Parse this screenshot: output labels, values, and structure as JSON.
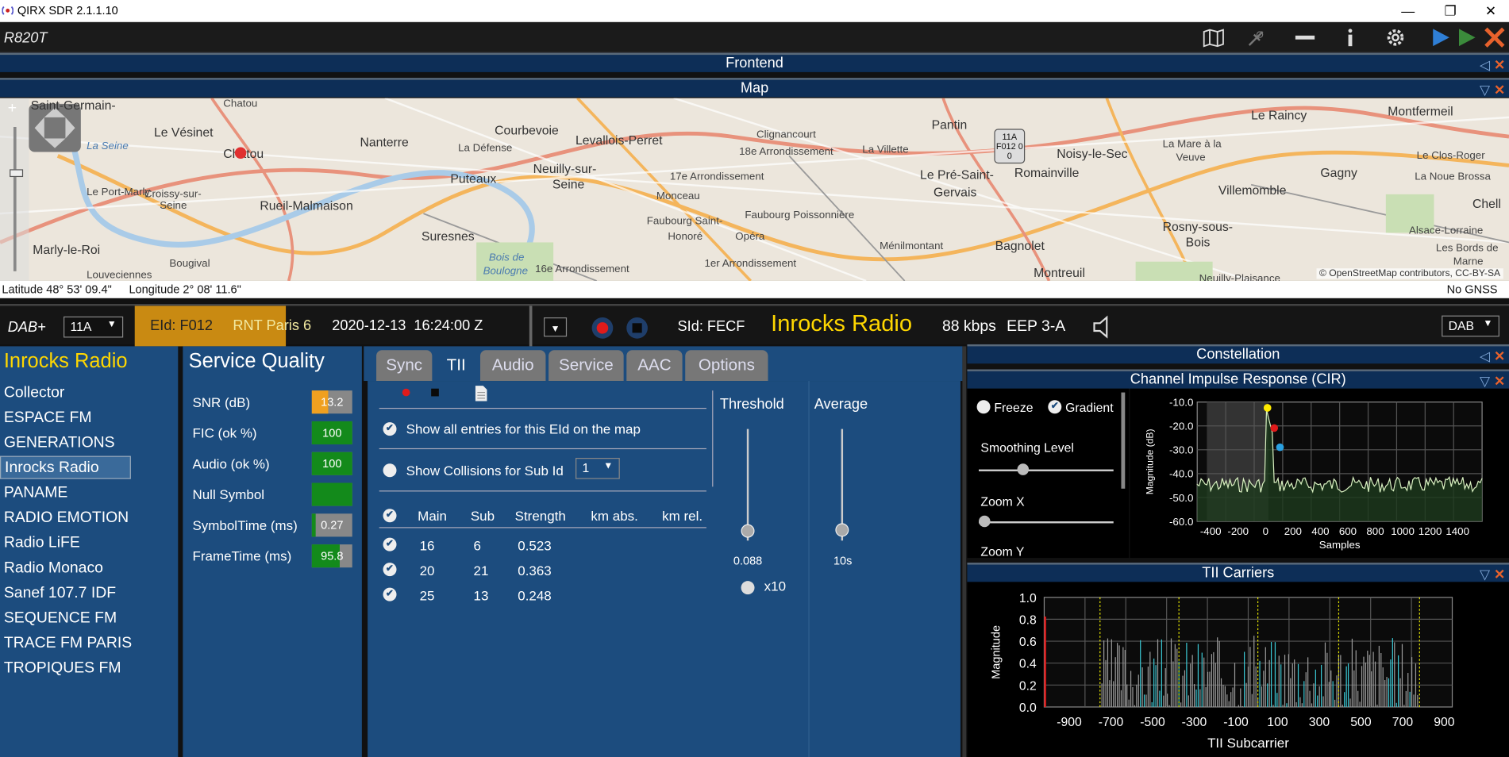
{
  "window": {
    "title": "QIRX SDR 2.1.1.10",
    "minimize": "—",
    "restore": "❐",
    "close": "✕"
  },
  "toolbar": {
    "device": "R820T"
  },
  "sections": {
    "frontend": "Frontend",
    "map": "Map",
    "constellation": "Constellation",
    "cir": "Channel Impulse Response (CIR)",
    "tii_carriers": "TII Carriers"
  },
  "map": {
    "labels": [
      {
        "t": "Saint-Germain-",
        "c": "sm"
      },
      {
        "t": "Chatou",
        "c": "sm"
      },
      {
        "t": "Le Vésinet",
        "c": ""
      },
      {
        "t": "Chatou",
        "c": ""
      },
      {
        "t": "Courbevoie",
        "c": ""
      },
      {
        "t": "Nanterre",
        "c": ""
      },
      {
        "t": "La Défense",
        "c": "sm"
      },
      {
        "t": "Levallois-Perret",
        "c": ""
      },
      {
        "t": "Clignancourt",
        "c": "sm"
      },
      {
        "t": "18e Arrondissement",
        "c": "sm"
      },
      {
        "t": "La Villette",
        "c": "sm"
      },
      {
        "t": "Pantin",
        "c": ""
      },
      {
        "t": "Le Raincy",
        "c": ""
      },
      {
        "t": "Montfermeil",
        "c": ""
      },
      {
        "t": "Puteaux",
        "c": ""
      },
      {
        "t": "Neuilly-sur-",
        "c": ""
      },
      {
        "t": "Seine",
        "c": ""
      },
      {
        "t": "17e Arrondissement",
        "c": "sm"
      },
      {
        "t": "Le Pré-Saint-",
        "c": ""
      },
      {
        "t": "Gervais",
        "c": ""
      },
      {
        "t": "Romainville",
        "c": ""
      },
      {
        "t": "Noisy-le-Sec",
        "c": ""
      },
      {
        "t": "La Mare à la",
        "c": "sm"
      },
      {
        "t": "Veuve",
        "c": "sm"
      },
      {
        "t": "Le Clos-Roger",
        "c": "sm"
      },
      {
        "t": "Gagny",
        "c": ""
      },
      {
        "t": "La Noue Brossa",
        "c": "sm"
      },
      {
        "t": "Le Port-Marly",
        "c": "sm"
      },
      {
        "t": "Croissy-sur-",
        "c": "sm"
      },
      {
        "t": "Seine",
        "c": "sm"
      },
      {
        "t": "Rueil-Malmaison",
        "c": ""
      },
      {
        "t": "Monceau",
        "c": "sm"
      },
      {
        "t": "Faubourg Poissonnière",
        "c": "sm"
      },
      {
        "t": "Villemomble",
        "c": ""
      },
      {
        "t": "Chell",
        "c": ""
      },
      {
        "t": "Suresnes",
        "c": ""
      },
      {
        "t": "Faubourg Saint-",
        "c": "sm"
      },
      {
        "t": "Honoré",
        "c": "sm"
      },
      {
        "t": "Opéra",
        "c": "sm"
      },
      {
        "t": "Rosny-sous-",
        "c": ""
      },
      {
        "t": "Bois",
        "c": ""
      },
      {
        "t": "Alsace-Lorraine",
        "c": "sm"
      },
      {
        "t": "Marly-le-Roi",
        "c": ""
      },
      {
        "t": "Ménilmontant",
        "c": "sm"
      },
      {
        "t": "Bagnolet",
        "c": ""
      },
      {
        "t": "Les Bords de",
        "c": "sm"
      },
      {
        "t": "Marne",
        "c": "sm"
      },
      {
        "t": "Bougival",
        "c": "sm"
      },
      {
        "t": "Bois de",
        "c": "it"
      },
      {
        "t": "Boulogne",
        "c": "it"
      },
      {
        "t": "16e Arrondissement",
        "c": "sm"
      },
      {
        "t": "1er Arrondissement",
        "c": "sm"
      },
      {
        "t": "Montreuil",
        "c": ""
      },
      {
        "t": "Louveciennes",
        "c": "sm"
      },
      {
        "t": "La Seine",
        "c": "it"
      },
      {
        "t": "Neuilly-Plaisance",
        "c": "sm"
      }
    ],
    "tii_marker": "11A F012 0 0",
    "attribution": "© OpenStreetMap contributors, CC-BY-SA"
  },
  "status": {
    "latitude": "Latitude  48° 53' 09.4\"",
    "longitude": "Longitude  2° 08' 11.6\"",
    "gnss": "No GNSS"
  },
  "dab": {
    "mode": "DAB+",
    "channel": "11A",
    "eid": "EId: F012",
    "ensemble": "RNT Paris 6",
    "datetime": "2020-12-13  16:24:00 Z",
    "sid": "SId: FECF",
    "service": "Inrocks Radio",
    "bitrate": "88 kbps",
    "protection": "EEP 3-A",
    "band": "DAB"
  },
  "services": {
    "title": "Inrocks Radio",
    "items": [
      "Collector",
      "ESPACE FM",
      "GENERATIONS",
      "Inrocks Radio",
      "PANAME",
      "RADIO EMOTION",
      "Radio LiFE",
      "Radio Monaco",
      "Sanef 107.7 IDF",
      "SEQUENCE FM",
      "TRACE FM PARIS",
      "TROPIQUES FM"
    ],
    "selected": "Inrocks Radio"
  },
  "quality": {
    "title": "Service Quality",
    "rows": [
      {
        "label": "SNR (dB)",
        "value": "13.2",
        "fill": 0.4,
        "color": "#f0a020"
      },
      {
        "label": "FIC (ok %)",
        "value": "100",
        "fill": 1.0,
        "color": "#138a1b"
      },
      {
        "label": "Audio (ok %)",
        "value": "100",
        "fill": 1.0,
        "color": "#138a1b"
      },
      {
        "label": "Null Symbol",
        "value": "",
        "fill": 1.0,
        "color": "#138a1b"
      },
      {
        "label": "SymbolTime (ms)",
        "value": "0.27",
        "fill": 0.1,
        "color": "#138a1b"
      },
      {
        "label": "FrameTime (ms)",
        "value": "95.8",
        "fill": 0.7,
        "color": "#138a1b"
      }
    ]
  },
  "tabs": [
    "Sync",
    "TII",
    "Audio",
    "Service",
    "AAC",
    "Options"
  ],
  "tii": {
    "show_all": "Show all entries for this EId on the map",
    "show_collisions": "Show Collisions for Sub Id",
    "sub_id": "1",
    "columns": [
      "Main",
      "Sub",
      "Strength",
      "km abs.",
      "km rel."
    ],
    "rows": [
      [
        "16",
        "6",
        "0.523"
      ],
      [
        "20",
        "21",
        "0.363"
      ],
      [
        "25",
        "13",
        "0.248"
      ]
    ],
    "threshold_label": "Threshold",
    "threshold_value": "0.088",
    "threshold_level": 0.088,
    "x10": "x10",
    "average_label": "Average",
    "average_value": "10s"
  },
  "cir": {
    "freeze": "Freeze",
    "gradient": "Gradient",
    "smoothing": "Smoothing Level",
    "zoomx": "Zoom X",
    "zoomy": "Zoom Y",
    "ylabel": "Magnitude (dB)",
    "xlabel": "Samples",
    "yticks": [
      "-10.0",
      "-20.0",
      "-30.0",
      "-40.0",
      "-50.0",
      "-60.0"
    ],
    "xticks": [
      "-400",
      "-200",
      "0",
      "200",
      "400",
      "600",
      "800",
      "1000",
      "1200",
      "1400"
    ]
  },
  "tiic": {
    "ylabel": "Magnitude",
    "xlabel": "TII Subcarrier",
    "yticks": [
      "1.0",
      "0.8",
      "0.6",
      "0.4",
      "0.2",
      "0.0"
    ],
    "xticks": [
      "-900",
      "-700",
      "-500",
      "-300",
      "-100",
      "100",
      "300",
      "500",
      "700",
      "900"
    ]
  },
  "colors": {
    "accent": "#ffd700",
    "panel": "#1c4c7e",
    "header": "#0d2e57",
    "ensemble_bg": "#c98a12",
    "close": "#e8622c"
  }
}
